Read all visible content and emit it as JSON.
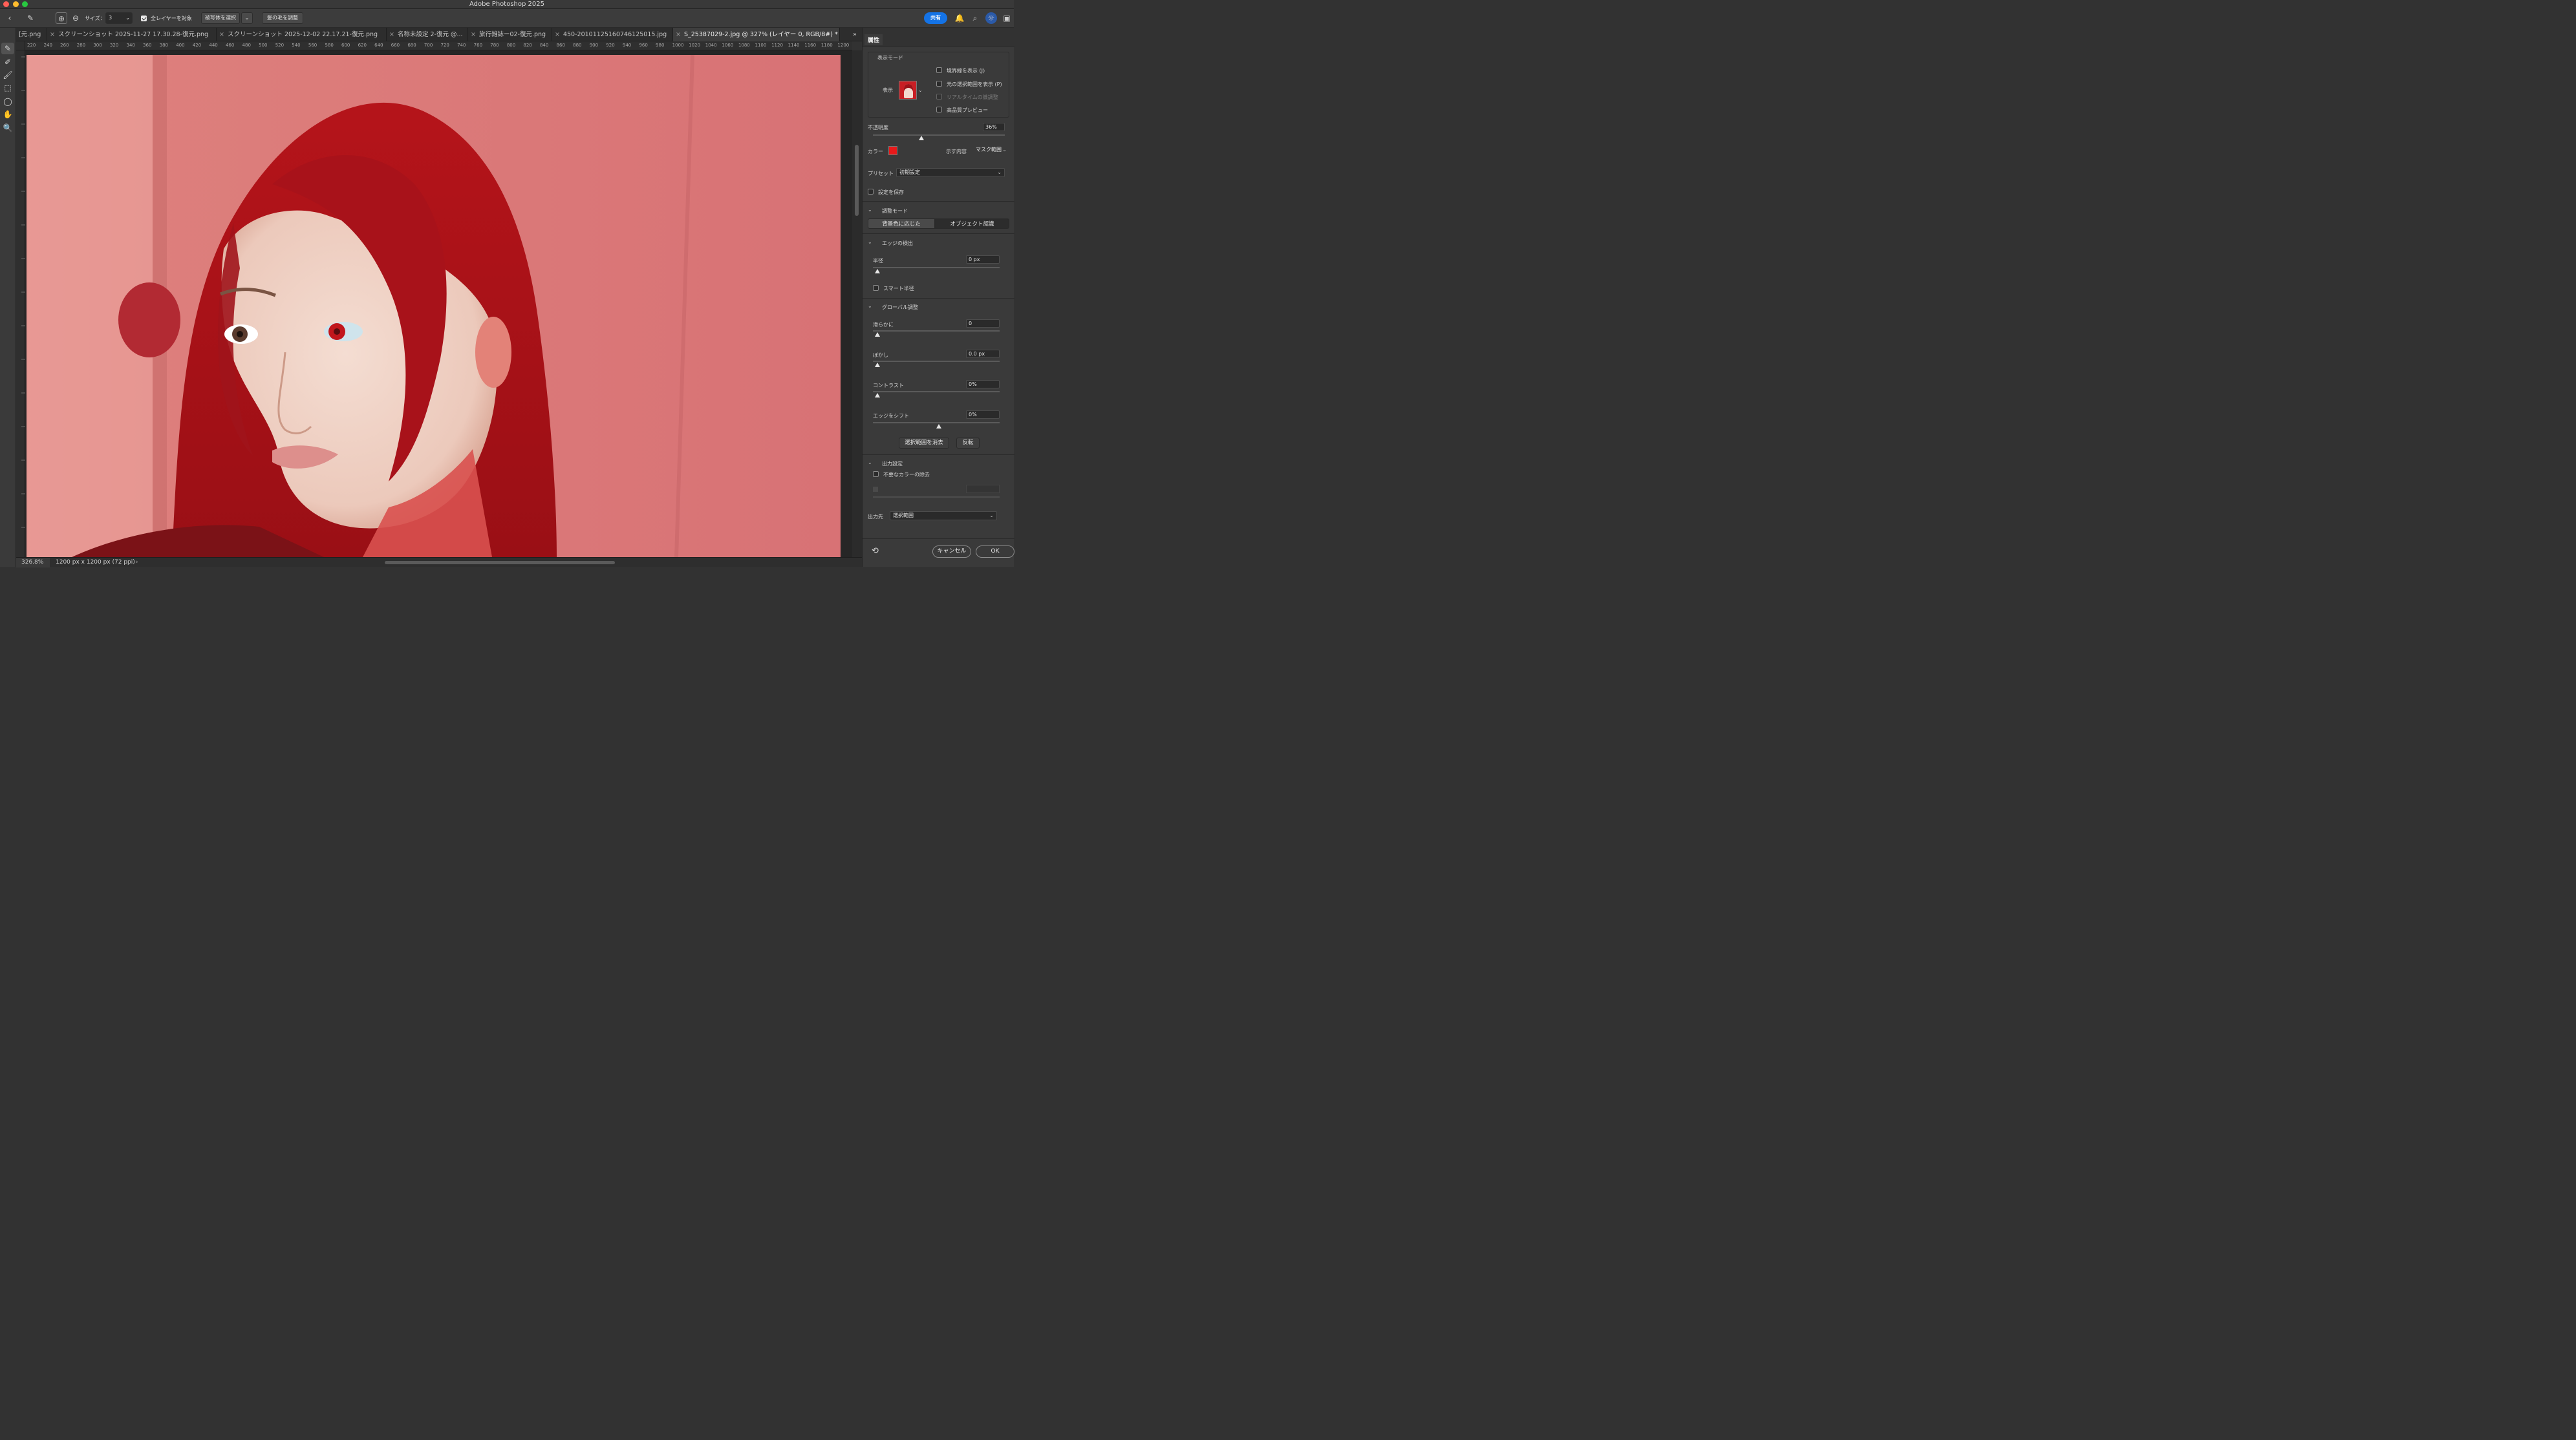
{
  "window": {
    "title": "Adobe Photoshop 2025"
  },
  "options": {
    "size_label": "サイズ：",
    "size_value": "3",
    "all_layers_label": "全レイヤーを対象",
    "select_subject_label": "被写体を選択",
    "refine_hair_label": "髪の毛を調整",
    "share_label": "共有"
  },
  "tabs": [
    {
      "label": "[元.png",
      "active": false
    },
    {
      "label": "スクリーンショット 2025-11-27 17.30.28-復元.png",
      "active": false
    },
    {
      "label": "スクリーンショット 2025-12-02 22.17.21-復元.png",
      "active": false
    },
    {
      "label": "名称未設定 2-復元 @...",
      "active": false
    },
    {
      "label": "旅行雑誌ー02-復元.png",
      "active": false
    },
    {
      "label": "450-20101125160746125015.jpg",
      "active": false
    },
    {
      "label": "S_25387029-2.jpg @ 327% (レイヤー 0, RGB/8#) *",
      "active": true
    }
  ],
  "ruler_labels": [
    "220",
    "240",
    "260",
    "280",
    "300",
    "320",
    "340",
    "360",
    "380",
    "400",
    "420",
    "440",
    "460",
    "480",
    "500",
    "520",
    "540",
    "560",
    "580",
    "600",
    "620",
    "640",
    "660",
    "680",
    "700",
    "720",
    "740",
    "760",
    "780",
    "800",
    "820",
    "840",
    "860",
    "880",
    "900",
    "920",
    "940",
    "960",
    "980",
    "1000",
    "1020",
    "1040",
    "1060",
    "1080",
    "1100",
    "1120",
    "1140",
    "1160",
    "1180",
    "1200"
  ],
  "status": {
    "zoom": "326.8%",
    "doc_info": "1200 px x 1200 px (72 ppi)"
  },
  "panel": {
    "tab_label": "属性",
    "view_mode_label": "表示モード",
    "view_label": "表示",
    "show_edge_label": "境界線を表示 (J)",
    "show_original_label": "元の選択範囲を表示 (P)",
    "realtime_label": "リアルタイムの微調整",
    "hq_preview_label": "高品質プレビュー",
    "opacity_label": "不透明度",
    "opacity_value": "36%",
    "opacity_level": 0.36,
    "color_label": "カラー",
    "overlay_color": "#e8191a",
    "indicates_label": "示す内容",
    "indicates_value": "マスク範囲",
    "preset_label": "プリセット",
    "preset_value": "初期設定",
    "save_settings_label": "設定を保存",
    "refine_mode_label": "調整モード",
    "mode_color_aware": "背景色に応じた",
    "mode_object_aware": "オブジェクト認識",
    "edge_detection_label": "エッジの検出",
    "radius_label": "半径",
    "radius_value": "0 px",
    "smart_radius_label": "スマート半径",
    "global_label": "グローバル調整",
    "smooth_label": "滑らかに",
    "smooth_value": "0",
    "feather_label": "ぼかし",
    "feather_value": "0.0 px",
    "contrast_label": "コントラスト",
    "contrast_value": "0%",
    "shift_edge_label": "エッジをシフト",
    "shift_edge_value": "0%",
    "clear_selection_label": "選択範囲を消去",
    "invert_label": "反転",
    "output_settings_label": "出力設定",
    "decontaminate_label": "不要なカラーの除去",
    "output_to_label": "出力先",
    "output_to_value": "選択範囲",
    "cancel_label": "キャンセル",
    "ok_label": "OK"
  }
}
